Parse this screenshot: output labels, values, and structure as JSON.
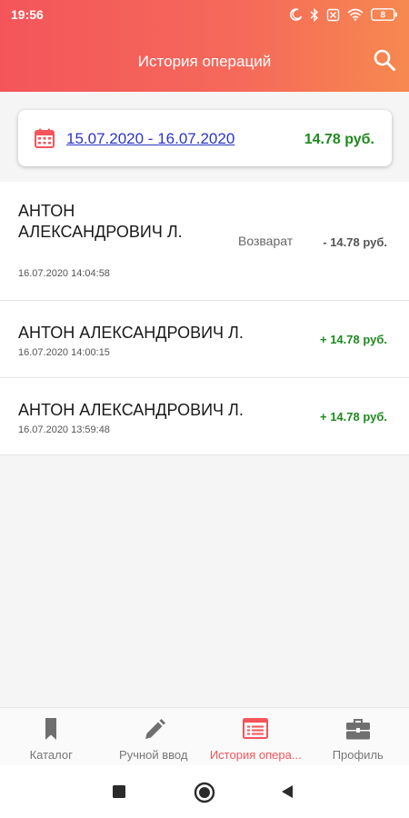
{
  "status_bar": {
    "time": "19:56",
    "battery": "8"
  },
  "header": {
    "title": "История операций"
  },
  "date_range": {
    "text": "15.07.2020 - 16.07.2020",
    "total": "14.78 руб."
  },
  "transactions": [
    {
      "name": "АНТОН АЛЕКСАНДРОВИЧ Л.",
      "time": "16.07.2020 14:04:58",
      "status": "Возварат",
      "amount": "- 14.78 руб."
    },
    {
      "name": "АНТОН АЛЕКСАНДРОВИЧ Л.",
      "time": "16.07.2020 14:00:15",
      "amount": "+ 14.78 руб."
    },
    {
      "name": "АНТОН АЛЕКСАНДРОВИЧ Л.",
      "time": "16.07.2020 13:59:48",
      "amount": "+ 14.78 руб."
    }
  ],
  "bottom_nav": [
    {
      "label": "Каталог",
      "icon": "bookmark-icon"
    },
    {
      "label": "Ручной ввод",
      "icon": "pencil-icon"
    },
    {
      "label": "История опера...",
      "icon": "history-list-icon",
      "active": true
    },
    {
      "label": "Профиль",
      "icon": "briefcase-icon"
    }
  ],
  "colors": {
    "accent": "#f4555a",
    "positive": "#1e8a1e",
    "link": "#2a35c7"
  }
}
